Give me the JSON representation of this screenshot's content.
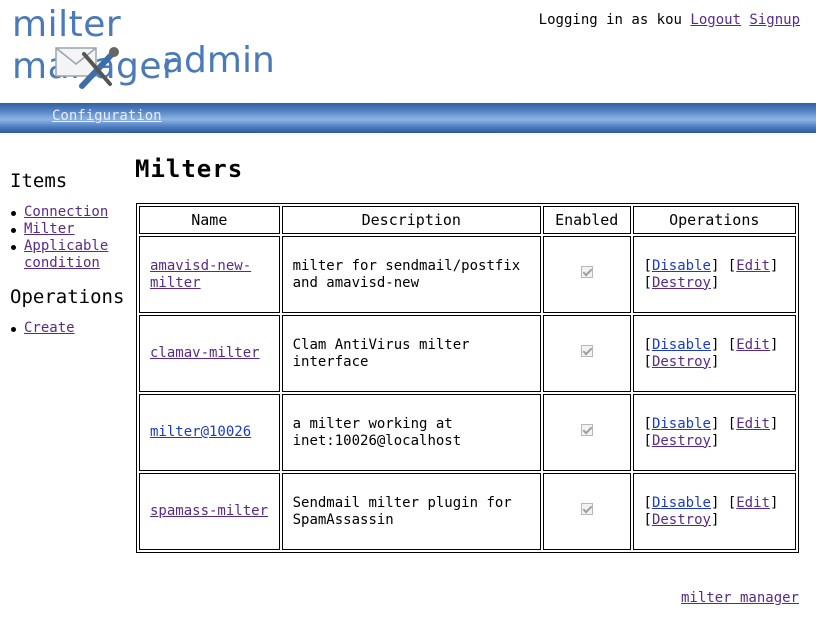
{
  "logo": {
    "line1": "milter manager",
    "line2": "admin"
  },
  "userbar": {
    "text": "Logging in as kou",
    "logout_label": "Logout",
    "signup_label": "Signup"
  },
  "nav": {
    "configuration_label": "Configuration"
  },
  "sidebar": {
    "items_heading": "Items",
    "items": [
      "Connection",
      "Milter",
      "Applicable condition"
    ],
    "operations_heading": "Operations",
    "operations": [
      "Create"
    ]
  },
  "main": {
    "title": "Milters",
    "columns": [
      "Name",
      "Description",
      "Enabled",
      "Operations"
    ],
    "rows": [
      {
        "name": "amavisd-new-milter",
        "description": "milter for sendmail/postfix and amavisd-new",
        "enabled": true
      },
      {
        "name": "clamav-milter",
        "description": "Clam AntiVirus milter interface",
        "enabled": true
      },
      {
        "name": "milter@10026",
        "description": "a milter working at inet:10026@localhost",
        "enabled": true
      },
      {
        "name": "spamass-milter",
        "description": "Sendmail milter plugin for SpamAssassin",
        "enabled": true
      }
    ],
    "ops": {
      "disable_label": "Disable",
      "edit_label": "Edit",
      "destroy_label": "Destroy"
    }
  },
  "footer": {
    "link_label": "milter manager"
  },
  "colors": {
    "brand": "#4a7ab8",
    "nav_bar": "#4c7cc0",
    "link_visited": "#5a2a8a",
    "link_fresh": "#1a3ac8"
  }
}
